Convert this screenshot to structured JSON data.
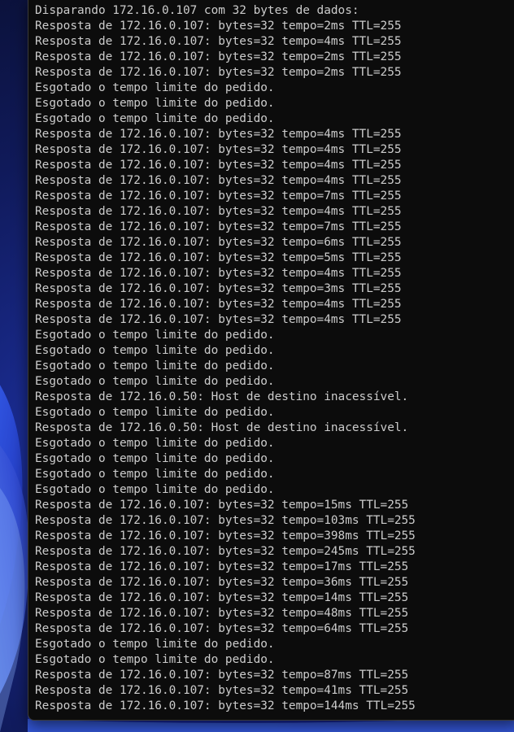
{
  "desktop": {
    "wallpaper": "windows-11-bloom",
    "colors": {
      "base": "#0b1030",
      "bloom_dark": "#1a2aa8",
      "bloom_light": "#4a7cff",
      "bloom_highlight": "#8fb4ff"
    }
  },
  "terminal": {
    "colors": {
      "background": "#0c0c0c",
      "text": "#cccccc"
    },
    "lines": [
      "Disparando 172.16.0.107 com 32 bytes de dados:",
      "Resposta de 172.16.0.107: bytes=32 tempo=2ms TTL=255",
      "Resposta de 172.16.0.107: bytes=32 tempo=4ms TTL=255",
      "Resposta de 172.16.0.107: bytes=32 tempo=2ms TTL=255",
      "Resposta de 172.16.0.107: bytes=32 tempo=2ms TTL=255",
      "Esgotado o tempo limite do pedido.",
      "Esgotado o tempo limite do pedido.",
      "Esgotado o tempo limite do pedido.",
      "Resposta de 172.16.0.107: bytes=32 tempo=4ms TTL=255",
      "Resposta de 172.16.0.107: bytes=32 tempo=4ms TTL=255",
      "Resposta de 172.16.0.107: bytes=32 tempo=4ms TTL=255",
      "Resposta de 172.16.0.107: bytes=32 tempo=4ms TTL=255",
      "Resposta de 172.16.0.107: bytes=32 tempo=7ms TTL=255",
      "Resposta de 172.16.0.107: bytes=32 tempo=4ms TTL=255",
      "Resposta de 172.16.0.107: bytes=32 tempo=7ms TTL=255",
      "Resposta de 172.16.0.107: bytes=32 tempo=6ms TTL=255",
      "Resposta de 172.16.0.107: bytes=32 tempo=5ms TTL=255",
      "Resposta de 172.16.0.107: bytes=32 tempo=4ms TTL=255",
      "Resposta de 172.16.0.107: bytes=32 tempo=3ms TTL=255",
      "Resposta de 172.16.0.107: bytes=32 tempo=4ms TTL=255",
      "Resposta de 172.16.0.107: bytes=32 tempo=4ms TTL=255",
      "Esgotado o tempo limite do pedido.",
      "Esgotado o tempo limite do pedido.",
      "Esgotado o tempo limite do pedido.",
      "Esgotado o tempo limite do pedido.",
      "Resposta de 172.16.0.50: Host de destino inacessível.",
      "Esgotado o tempo limite do pedido.",
      "Resposta de 172.16.0.50: Host de destino inacessível.",
      "Esgotado o tempo limite do pedido.",
      "Esgotado o tempo limite do pedido.",
      "Esgotado o tempo limite do pedido.",
      "Esgotado o tempo limite do pedido.",
      "Resposta de 172.16.0.107: bytes=32 tempo=15ms TTL=255",
      "Resposta de 172.16.0.107: bytes=32 tempo=103ms TTL=255",
      "Resposta de 172.16.0.107: bytes=32 tempo=398ms TTL=255",
      "Resposta de 172.16.0.107: bytes=32 tempo=245ms TTL=255",
      "Resposta de 172.16.0.107: bytes=32 tempo=17ms TTL=255",
      "Resposta de 172.16.0.107: bytes=32 tempo=36ms TTL=255",
      "Resposta de 172.16.0.107: bytes=32 tempo=14ms TTL=255",
      "Resposta de 172.16.0.107: bytes=32 tempo=48ms TTL=255",
      "Resposta de 172.16.0.107: bytes=32 tempo=64ms TTL=255",
      "Esgotado o tempo limite do pedido.",
      "Esgotado o tempo limite do pedido.",
      "Resposta de 172.16.0.107: bytes=32 tempo=87ms TTL=255",
      "Resposta de 172.16.0.107: bytes=32 tempo=41ms TTL=255",
      "Resposta de 172.16.0.107: bytes=32 tempo=144ms TTL=255"
    ]
  }
}
